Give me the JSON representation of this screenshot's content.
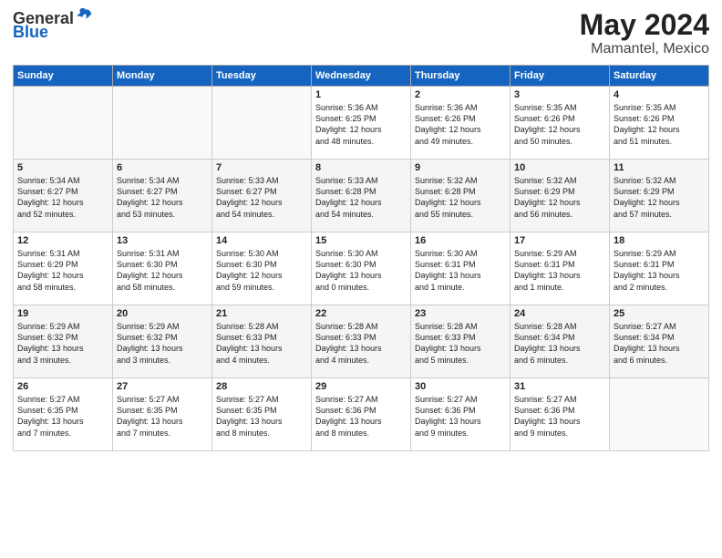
{
  "header": {
    "logo_general": "General",
    "logo_blue": "Blue",
    "month": "May 2024",
    "location": "Mamantel, Mexico"
  },
  "weekdays": [
    "Sunday",
    "Monday",
    "Tuesday",
    "Wednesday",
    "Thursday",
    "Friday",
    "Saturday"
  ],
  "weeks": [
    [
      {
        "day": "",
        "text": ""
      },
      {
        "day": "",
        "text": ""
      },
      {
        "day": "",
        "text": ""
      },
      {
        "day": "1",
        "text": "Sunrise: 5:36 AM\nSunset: 6:25 PM\nDaylight: 12 hours\nand 48 minutes."
      },
      {
        "day": "2",
        "text": "Sunrise: 5:36 AM\nSunset: 6:26 PM\nDaylight: 12 hours\nand 49 minutes."
      },
      {
        "day": "3",
        "text": "Sunrise: 5:35 AM\nSunset: 6:26 PM\nDaylight: 12 hours\nand 50 minutes."
      },
      {
        "day": "4",
        "text": "Sunrise: 5:35 AM\nSunset: 6:26 PM\nDaylight: 12 hours\nand 51 minutes."
      }
    ],
    [
      {
        "day": "5",
        "text": "Sunrise: 5:34 AM\nSunset: 6:27 PM\nDaylight: 12 hours\nand 52 minutes."
      },
      {
        "day": "6",
        "text": "Sunrise: 5:34 AM\nSunset: 6:27 PM\nDaylight: 12 hours\nand 53 minutes."
      },
      {
        "day": "7",
        "text": "Sunrise: 5:33 AM\nSunset: 6:27 PM\nDaylight: 12 hours\nand 54 minutes."
      },
      {
        "day": "8",
        "text": "Sunrise: 5:33 AM\nSunset: 6:28 PM\nDaylight: 12 hours\nand 54 minutes."
      },
      {
        "day": "9",
        "text": "Sunrise: 5:32 AM\nSunset: 6:28 PM\nDaylight: 12 hours\nand 55 minutes."
      },
      {
        "day": "10",
        "text": "Sunrise: 5:32 AM\nSunset: 6:29 PM\nDaylight: 12 hours\nand 56 minutes."
      },
      {
        "day": "11",
        "text": "Sunrise: 5:32 AM\nSunset: 6:29 PM\nDaylight: 12 hours\nand 57 minutes."
      }
    ],
    [
      {
        "day": "12",
        "text": "Sunrise: 5:31 AM\nSunset: 6:29 PM\nDaylight: 12 hours\nand 58 minutes."
      },
      {
        "day": "13",
        "text": "Sunrise: 5:31 AM\nSunset: 6:30 PM\nDaylight: 12 hours\nand 58 minutes."
      },
      {
        "day": "14",
        "text": "Sunrise: 5:30 AM\nSunset: 6:30 PM\nDaylight: 12 hours\nand 59 minutes."
      },
      {
        "day": "15",
        "text": "Sunrise: 5:30 AM\nSunset: 6:30 PM\nDaylight: 13 hours\nand 0 minutes."
      },
      {
        "day": "16",
        "text": "Sunrise: 5:30 AM\nSunset: 6:31 PM\nDaylight: 13 hours\nand 1 minute."
      },
      {
        "day": "17",
        "text": "Sunrise: 5:29 AM\nSunset: 6:31 PM\nDaylight: 13 hours\nand 1 minute."
      },
      {
        "day": "18",
        "text": "Sunrise: 5:29 AM\nSunset: 6:31 PM\nDaylight: 13 hours\nand 2 minutes."
      }
    ],
    [
      {
        "day": "19",
        "text": "Sunrise: 5:29 AM\nSunset: 6:32 PM\nDaylight: 13 hours\nand 3 minutes."
      },
      {
        "day": "20",
        "text": "Sunrise: 5:29 AM\nSunset: 6:32 PM\nDaylight: 13 hours\nand 3 minutes."
      },
      {
        "day": "21",
        "text": "Sunrise: 5:28 AM\nSunset: 6:33 PM\nDaylight: 13 hours\nand 4 minutes."
      },
      {
        "day": "22",
        "text": "Sunrise: 5:28 AM\nSunset: 6:33 PM\nDaylight: 13 hours\nand 4 minutes."
      },
      {
        "day": "23",
        "text": "Sunrise: 5:28 AM\nSunset: 6:33 PM\nDaylight: 13 hours\nand 5 minutes."
      },
      {
        "day": "24",
        "text": "Sunrise: 5:28 AM\nSunset: 6:34 PM\nDaylight: 13 hours\nand 6 minutes."
      },
      {
        "day": "25",
        "text": "Sunrise: 5:27 AM\nSunset: 6:34 PM\nDaylight: 13 hours\nand 6 minutes."
      }
    ],
    [
      {
        "day": "26",
        "text": "Sunrise: 5:27 AM\nSunset: 6:35 PM\nDaylight: 13 hours\nand 7 minutes."
      },
      {
        "day": "27",
        "text": "Sunrise: 5:27 AM\nSunset: 6:35 PM\nDaylight: 13 hours\nand 7 minutes."
      },
      {
        "day": "28",
        "text": "Sunrise: 5:27 AM\nSunset: 6:35 PM\nDaylight: 13 hours\nand 8 minutes."
      },
      {
        "day": "29",
        "text": "Sunrise: 5:27 AM\nSunset: 6:36 PM\nDaylight: 13 hours\nand 8 minutes."
      },
      {
        "day": "30",
        "text": "Sunrise: 5:27 AM\nSunset: 6:36 PM\nDaylight: 13 hours\nand 9 minutes."
      },
      {
        "day": "31",
        "text": "Sunrise: 5:27 AM\nSunset: 6:36 PM\nDaylight: 13 hours\nand 9 minutes."
      },
      {
        "day": "",
        "text": ""
      }
    ]
  ]
}
